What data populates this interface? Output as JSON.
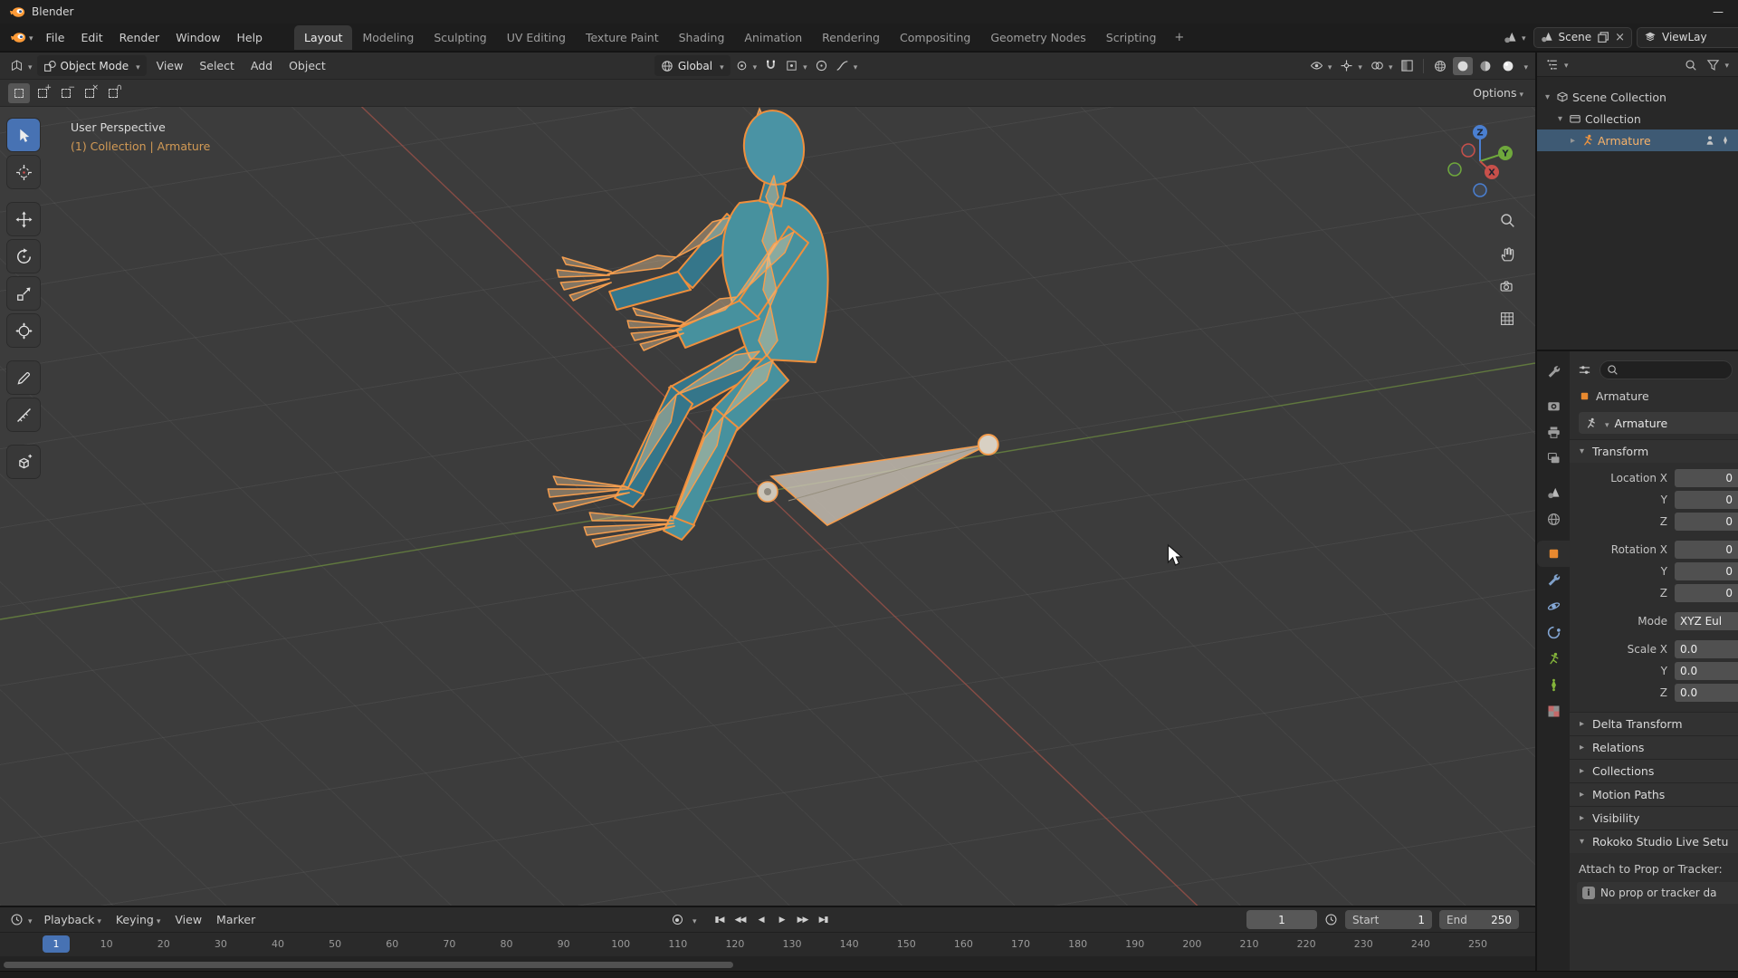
{
  "colors": {
    "accent_orange": "#e8892f",
    "selection_blue": "#4772b3",
    "outliner_selection": "#3e5a74",
    "axis_x_red": "#a8544a",
    "axis_y_green": "#6d8c3f",
    "gizmo_z_blue": "#4a7fd1"
  },
  "titlebar": {
    "app_name": "Blender",
    "minimize_glyph": "—"
  },
  "menubar": {
    "menus": [
      "File",
      "Edit",
      "Render",
      "Window",
      "Help"
    ],
    "workspaces": [
      "Layout",
      "Modeling",
      "Sculpting",
      "UV Editing",
      "Texture Paint",
      "Shading",
      "Animation",
      "Rendering",
      "Compositing",
      "Geometry Nodes",
      "Scripting"
    ],
    "active_workspace": "Layout",
    "add_workspace_label": "+",
    "scene_selector": {
      "label": "Scene"
    },
    "view_layer_selector": {
      "label": "ViewLay"
    }
  },
  "viewport": {
    "header": {
      "mode": "Object Mode",
      "menus": [
        "View",
        "Select",
        "Add",
        "Object"
      ],
      "orientation": "Global",
      "options_button": "Options"
    },
    "select_modes": [
      "set",
      "extend",
      "subtract",
      "invert",
      "intersect"
    ],
    "tools": [
      "tweak",
      "cursor",
      "move",
      "rotate",
      "scale",
      "transform",
      "annotate",
      "measure",
      "add-cube"
    ],
    "active_tool": "tweak",
    "overlay": {
      "perspective_label": "User Perspective",
      "context_label": "(1) Collection | Armature"
    },
    "gizmo": {
      "x": "X",
      "y": "Y",
      "z": "Z"
    }
  },
  "outliner": {
    "rows": [
      {
        "label": "Scene Collection",
        "icon": "scene-collection",
        "depth": 0,
        "disclosure": "open",
        "selected": false
      },
      {
        "label": "Collection",
        "icon": "collection",
        "depth": 1,
        "disclosure": "open",
        "selected": false
      },
      {
        "label": "Armature",
        "icon": "armature",
        "depth": 2,
        "disclosure": "closed",
        "selected": true
      }
    ]
  },
  "properties": {
    "tab_groups": [
      [
        "tool"
      ],
      [
        "render",
        "output",
        "view-layer"
      ],
      [
        "scene",
        "world"
      ],
      [
        "object",
        "modifiers",
        "physics",
        "constraints",
        "object-data",
        "bone",
        "texture"
      ]
    ],
    "active_tab": "object",
    "breadcrumb": "Armature",
    "datablock_name": "Armature",
    "transform_section": "Transform",
    "fields": [
      {
        "label": "Location X",
        "value": "0",
        "align": "right",
        "gap_before": false
      },
      {
        "label": "Y",
        "value": "0",
        "align": "right",
        "gap_before": false
      },
      {
        "label": "Z",
        "value": "0",
        "align": "right",
        "gap_before": false
      },
      {
        "label": "Rotation X",
        "value": "0",
        "align": "right",
        "gap_before": true
      },
      {
        "label": "Y",
        "value": "0",
        "align": "right",
        "gap_before": false
      },
      {
        "label": "Z",
        "value": "0",
        "align": "right",
        "gap_before": false
      },
      {
        "label": "Mode",
        "value": "XYZ Eul",
        "align": "left",
        "gap_before": true
      },
      {
        "label": "Scale X",
        "value": "0.0",
        "align": "left",
        "gap_before": true
      },
      {
        "label": "Y",
        "value": "0.0",
        "align": "left",
        "gap_before": false
      },
      {
        "label": "Z",
        "value": "0.0",
        "align": "left",
        "gap_before": false
      }
    ],
    "collapsed_sections": [
      "Delta Transform",
      "Relations",
      "Collections",
      "Motion Paths",
      "Visibility"
    ],
    "rokoko_section": "Rokoko Studio Live Setu",
    "attach_label": "Attach to Prop or Tracker:",
    "info_message": "No prop or tracker da"
  },
  "timeline": {
    "menus": [
      {
        "label": "Playback",
        "caret": true
      },
      {
        "label": "Keying",
        "caret": true
      },
      {
        "label": "View",
        "caret": false
      },
      {
        "label": "Marker",
        "caret": false
      }
    ],
    "transport": [
      {
        "name": "jump-to-start",
        "glyph": "▮◀"
      },
      {
        "name": "previous-keyframe",
        "glyph": "◀◀"
      },
      {
        "name": "play-reverse",
        "glyph": "◀"
      },
      {
        "name": "play",
        "glyph": "▶"
      },
      {
        "name": "next-keyframe",
        "glyph": "▶▶"
      },
      {
        "name": "jump-to-end",
        "glyph": "▶▮"
      }
    ],
    "current_frame": "1",
    "start_label": "Start",
    "start_value": "1",
    "end_label": "End",
    "end_value": "250",
    "ticks": [
      10,
      20,
      30,
      40,
      50,
      60,
      70,
      80,
      90,
      100,
      110,
      120,
      130,
      140,
      150,
      160,
      170,
      180,
      190,
      200,
      210,
      220,
      230,
      240,
      250
    ]
  }
}
